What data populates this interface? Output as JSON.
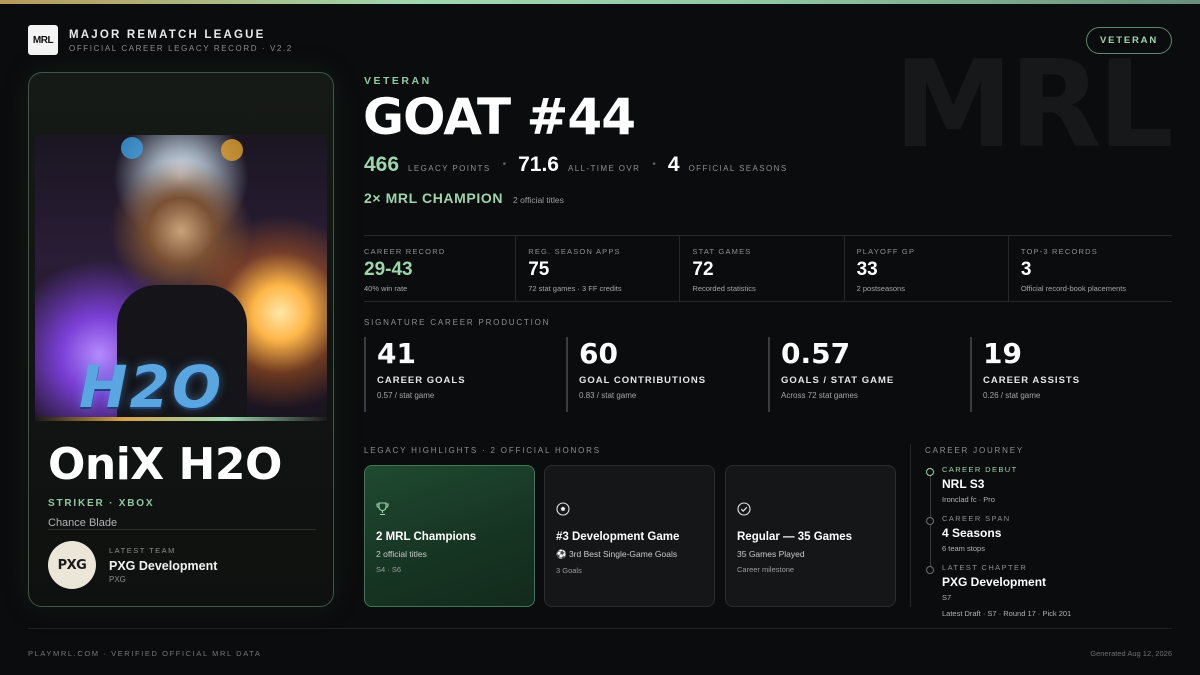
{
  "header": {
    "logo_text": "MRL",
    "league_name": "MAJOR REMATCH LEAGUE",
    "subtitle": "OFFICIAL CAREER LEGACY RECORD · V2.2",
    "tier_badge": "VETERAN",
    "watermark": "MRL"
  },
  "player": {
    "name": "OniX H2O",
    "role": "STRIKER · XBOX",
    "alias": "Chance Blade",
    "portrait_text": "H2O",
    "team": {
      "label": "LATEST TEAM",
      "name": "PXG Development",
      "abbr": "PXG",
      "logo_text": "PXG"
    }
  },
  "hero": {
    "tier": "VETERAN",
    "title": "GOAT #44",
    "stats": [
      {
        "value": "466",
        "label": "LEGACY POINTS"
      },
      {
        "value": "71.6",
        "label": "ALL-TIME OVR"
      },
      {
        "value": "4",
        "label": "OFFICIAL SEASONS"
      }
    ],
    "championships": "2× MRL CHAMPION",
    "championships_sub": "2 official titles"
  },
  "career_stats": [
    {
      "label": "CAREER RECORD",
      "value": "29-43",
      "sub": "40% win rate"
    },
    {
      "label": "REG. SEASON APPS",
      "value": "75",
      "sub": "72 stat games · 3 FF credits"
    },
    {
      "label": "STAT GAMES",
      "value": "72",
      "sub": "Recorded statistics"
    },
    {
      "label": "PLAYOFF GP",
      "value": "33",
      "sub": "2 postseasons"
    },
    {
      "label": "TOP-3 RECORDS",
      "value": "3",
      "sub": "Official record-book placements"
    }
  ],
  "production": {
    "label": "SIGNATURE CAREER PRODUCTION",
    "items": [
      {
        "value": "41",
        "label": "CAREER GOALS",
        "sub": "0.57 / stat game"
      },
      {
        "value": "60",
        "label": "GOAL CONTRIBUTIONS",
        "sub": "0.83 / stat game"
      },
      {
        "value": "0.57",
        "label": "GOALS / STAT GAME",
        "sub": "Across 72 stat games"
      },
      {
        "value": "19",
        "label": "CAREER ASSISTS",
        "sub": "0.26 / stat game"
      }
    ]
  },
  "highlights": {
    "label": "LEGACY HIGHLIGHTS · 2 OFFICIAL HONORS",
    "items": [
      {
        "icon": "trophy-icon",
        "glyph": "🏆",
        "title": "2 MRL Champions",
        "sub": "2 official titles",
        "meta": "S4 · S6"
      },
      {
        "icon": "soccer-ball-icon",
        "glyph": "⚽",
        "title": "#3 Development Game",
        "sub": "⚽ 3rd Best Single-Game Goals",
        "meta": "3 Goals"
      },
      {
        "icon": "check-circle-icon",
        "glyph": "✓",
        "title": "Regular — 35 Games",
        "sub": "35 Games Played",
        "meta": "Career milestone"
      }
    ]
  },
  "journey": {
    "label": "CAREER JOURNEY",
    "items": [
      {
        "label": "CAREER DEBUT",
        "title": "NRL S3",
        "sub": "Ironclad fc · Pro"
      },
      {
        "label": "CAREER SPAN",
        "title": "4 Seasons",
        "sub": "6 team stops"
      },
      {
        "label": "LATEST CHAPTER",
        "title": "PXG Development",
        "sub": "S7"
      }
    ],
    "draft": "Latest Draft · S7 · Round 17 · Pick 201"
  },
  "footer": {
    "left": "PLAYMRL.COM · VERIFIED OFFICIAL MRL DATA",
    "right": "Generated Aug 12, 2026"
  },
  "colors": {
    "accent": "#9fd5ae",
    "background": "#0b0c0d",
    "card_border": "#3d5947"
  }
}
